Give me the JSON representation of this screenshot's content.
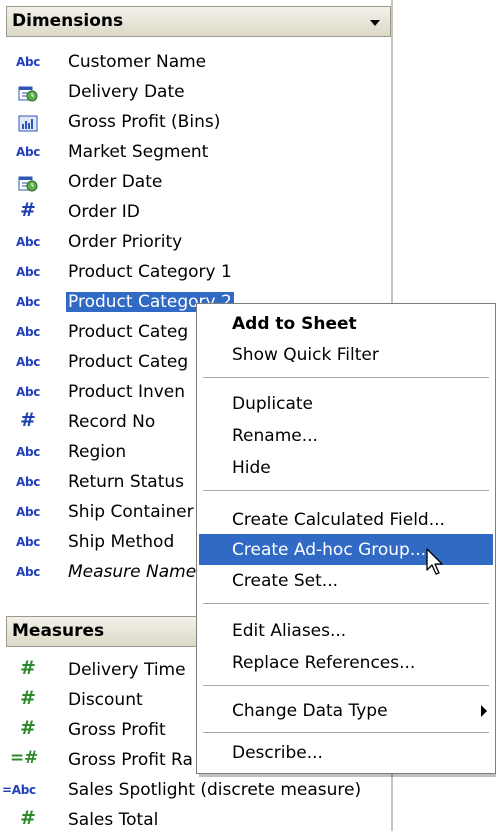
{
  "dimensions": {
    "title": "Dimensions",
    "items": [
      {
        "icon": "Abc",
        "label": "Customer Name"
      },
      {
        "icon": "calendar",
        "label": "Delivery Date"
      },
      {
        "icon": "bins",
        "label": "Gross Profit (Bins)"
      },
      {
        "icon": "Abc",
        "label": "Market Segment"
      },
      {
        "icon": "calendar",
        "label": "Order Date"
      },
      {
        "icon": "#",
        "label": "Order ID"
      },
      {
        "icon": "Abc",
        "label": "Order Priority"
      },
      {
        "icon": "Abc",
        "label": "Product Category 1"
      },
      {
        "icon": "Abc",
        "label": "Product Category 2"
      },
      {
        "icon": "Abc",
        "label": "Product Categ"
      },
      {
        "icon": "Abc",
        "label": "Product Categ"
      },
      {
        "icon": "Abc",
        "label": "Product Inven"
      },
      {
        "icon": "#",
        "label": "Record No"
      },
      {
        "icon": "Abc",
        "label": "Region"
      },
      {
        "icon": "Abc",
        "label": "Return Status"
      },
      {
        "icon": "Abc",
        "label": "Ship Container"
      },
      {
        "icon": "Abc",
        "label": "Ship Method"
      },
      {
        "icon": "Abc",
        "label": "Measure Name"
      }
    ]
  },
  "measures": {
    "title": "Measures",
    "items": [
      {
        "icon": "#",
        "label": "Delivery Time"
      },
      {
        "icon": "#",
        "label": "Discount"
      },
      {
        "icon": "#",
        "label": "Gross Profit"
      },
      {
        "icon": "=#",
        "label": "Gross Profit Ra"
      },
      {
        "icon": "=Abc",
        "label": "Sales Spotlight (discrete measure)"
      },
      {
        "icon": "#",
        "label": "Sales Total"
      }
    ]
  },
  "context_menu": {
    "items": [
      "Add to Sheet",
      "Show Quick Filter",
      "Duplicate",
      "Rename...",
      "Hide",
      "Create Calculated Field...",
      "Create Ad-hoc Group...",
      "Create Set...",
      "Edit Aliases...",
      "Replace References...",
      "Change Data Type",
      "Describe..."
    ]
  },
  "colors": {
    "selection": "#316ac5",
    "dimension_icon": "#2141b8",
    "measure_icon": "#2a8a2a"
  }
}
